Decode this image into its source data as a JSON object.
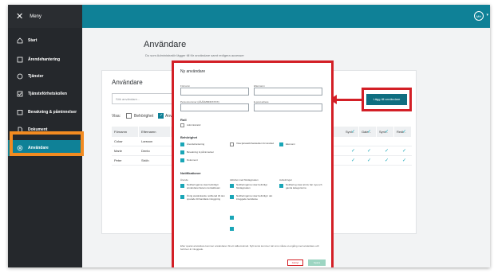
{
  "topbar": {
    "menu_label": "Meny",
    "close_icon": "close-icon",
    "user_initials": "MH"
  },
  "sidebar": {
    "items": [
      {
        "label": "Start",
        "icon": "home-icon"
      },
      {
        "label": "Ärendehantering",
        "icon": "cases-icon"
      },
      {
        "label": "Tjänster",
        "icon": "services-icon"
      },
      {
        "label": "Tjänsteförhetskollen",
        "icon": "check-icon"
      },
      {
        "label": "Bevakning & påminnelser",
        "icon": "bell-icon"
      },
      {
        "label": "Dokument",
        "icon": "document-icon"
      },
      {
        "label": "Användare",
        "icon": "gear-icon"
      }
    ]
  },
  "main": {
    "title": "Användare",
    "subtitle": "Du som Administratör lägger till för användare samt redigera accesser"
  },
  "card": {
    "title": "Användare",
    "search_placeholder": "Sök användare...",
    "visa_label": "Visa:",
    "filter_behorighet": "Behörighet",
    "filter_anvandare": "Anv",
    "add_button": "Lägg till användare",
    "columns": [
      "Förnamn",
      "Efternamn",
      "Synl...",
      "Gale...",
      "Synl...",
      "Redi..."
    ],
    "rows": [
      [
        "Cokar",
        "Larsson"
      ],
      [
        "Marie",
        "Dento"
      ],
      [
        "Peter",
        "Ströh"
      ]
    ]
  },
  "modal": {
    "title": "Ny användare",
    "fields": {
      "fornamn": "Förnamn",
      "efternamn": "Efternamn",
      "personnummer": "Personnummer (ÅÅÅÅMMDDXXXX)",
      "epost": "E-post adress",
      "roll": "Roll"
    },
    "roll_option": "Administratör",
    "behorighet_title": "Behörighet",
    "behorighet": [
      {
        "label": "Ärendehantering",
        "checked": true
      },
      {
        "label": "Visa tjänsteförhetskollen för ändrad",
        "checked": false
      },
      {
        "label": "Ekonomi",
        "checked": true
      },
      {
        "label": "Bevakning & påminnelser",
        "checked": true
      },
      {
        "label": "Dokument",
        "checked": true
      }
    ],
    "notiser_title": "Notifikationer",
    "notiser_cols": [
      "Ärende",
      "Aktivitet med förslagsvalen",
      "Avdelningar"
    ],
    "notiser_items": [
      "Notifieringarna visar befintligt i användarenhetens kontaktteam",
      "Övrig avstänkande notifierad till den sparade förhandlade inloggning",
      "Notifieringarna visar befintligt förslagsvalen",
      "Notifieringarna visar befintligt i det inloggade berättelse",
      "Notifiering visar att du har nya och gamla kategorierna"
    ],
    "footnote": "Efter sparat användare kommer användaren bli ett välkomstmail. Nytt konto kommer när sms måste ut engång med användare och behöver är inloggade.",
    "cancel": "Avbryt",
    "save": "Spara"
  },
  "colors": {
    "accent": "#0f8197",
    "highlight_red": "#d31f26",
    "highlight_orange": "#f28b21",
    "sidebar_bg": "#25282c"
  }
}
